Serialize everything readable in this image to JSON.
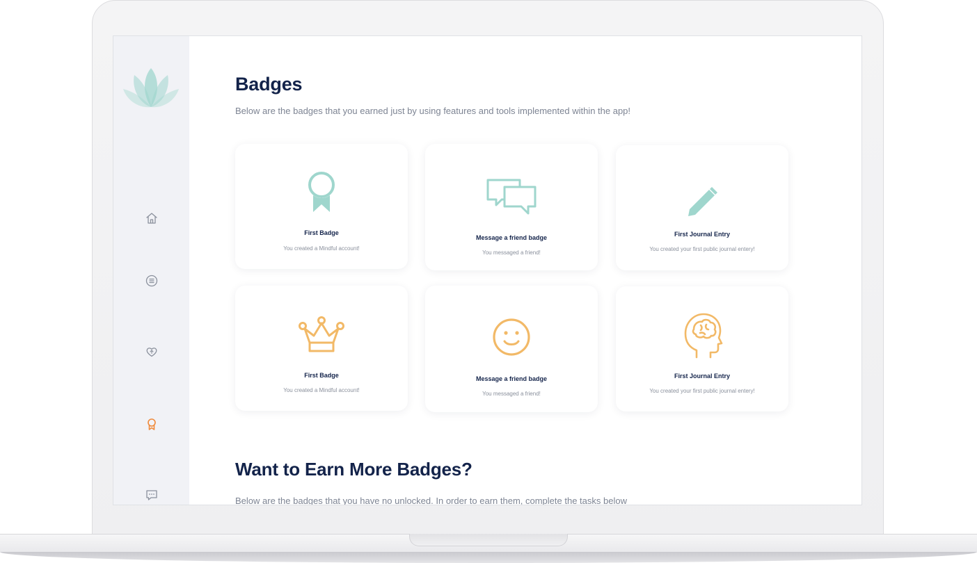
{
  "sidebar": {
    "logo_icon": "lotus-logo-icon",
    "items": [
      {
        "name": "home",
        "icon": "home-icon",
        "active": false
      },
      {
        "name": "list",
        "icon": "list-icon",
        "active": false
      },
      {
        "name": "heart",
        "icon": "heart-plus-icon",
        "active": false
      },
      {
        "name": "badges",
        "icon": "award-icon",
        "active": true
      },
      {
        "name": "messages",
        "icon": "chat-icon",
        "active": false
      }
    ]
  },
  "colors": {
    "accent_active": "#f08a3b",
    "teal": "#9fd6cd",
    "orange": "#f2b967",
    "heading": "#13234a",
    "muted": "#7d8493",
    "sidebar_bg": "#f1f2f6"
  },
  "page": {
    "title": "Badges",
    "subtitle": "Below are the badges that you earned just by using features and tools implemented within the app!"
  },
  "badges": [
    {
      "icon": "ribbon-award-icon",
      "title": "First Badge",
      "description": "You created a Mindful account!"
    },
    {
      "icon": "chat-bubbles-icon",
      "title": "Message a friend badge",
      "description": "You messaged a friend!"
    },
    {
      "icon": "pencil-icon",
      "title": "First Journal Entry",
      "description": "You created your first public journal entery!"
    },
    {
      "icon": "crown-icon",
      "title": "First Badge",
      "description": "You created a Mindful account!"
    },
    {
      "icon": "smiley-icon",
      "title": "Message a friend badge",
      "description": "You messaged a friend!"
    },
    {
      "icon": "brain-head-icon",
      "title": "First Journal Entry",
      "description": "You created your first public journal entery!"
    }
  ],
  "more": {
    "title": "Want to Earn More Badges?",
    "subtitle": "Below are the badges that you have no unlocked. In order to earn them, complete the tasks below"
  }
}
